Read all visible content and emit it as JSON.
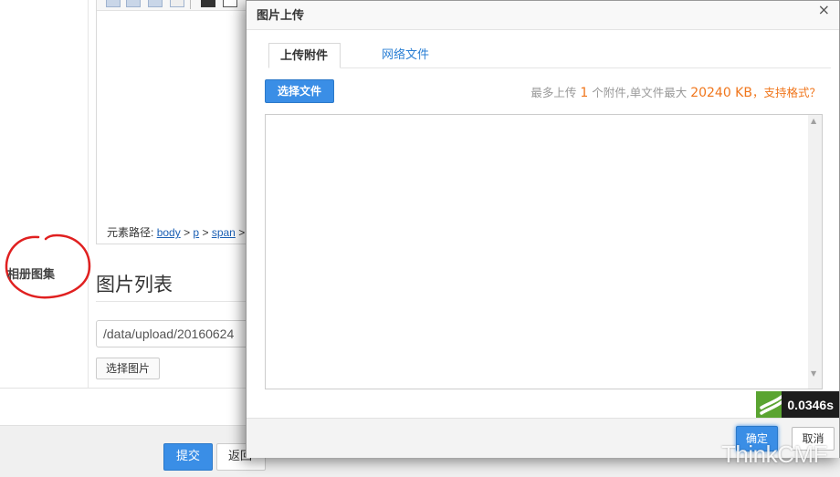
{
  "background_form": {
    "element_path_label": "元素路径:",
    "element_path_items": [
      "body",
      "p",
      "span"
    ],
    "separator": ">",
    "album_label": "相册图集",
    "image_list_title": "图片列表",
    "image_path_value": "/data/upload/20160624",
    "select_image_button": "选择图片",
    "submit_button": "提交",
    "back_button": "返回"
  },
  "dialog": {
    "title": "图片上传",
    "close_glyph": "×",
    "tabs": [
      {
        "label": "上传附件",
        "active": true
      },
      {
        "label": "网络文件",
        "active": false
      }
    ],
    "select_file_button": "选择文件",
    "upload_info": {
      "prefix": "最多上传",
      "max_count": "1",
      "middle": "个附件,单文件最大",
      "max_size": "20240 KB",
      "suffix": "，",
      "formats_link": "支持格式？"
    },
    "ok_button": "确定",
    "cancel_button": "取消"
  },
  "debug_badge": {
    "time": "0.0346s"
  },
  "watermark": "ThinkCMF",
  "colors": {
    "primary": "#3a8ee6",
    "accent_orange": "#f0761c",
    "annotation_red": "#e02020",
    "debug_logo_green": "#5aa431"
  }
}
